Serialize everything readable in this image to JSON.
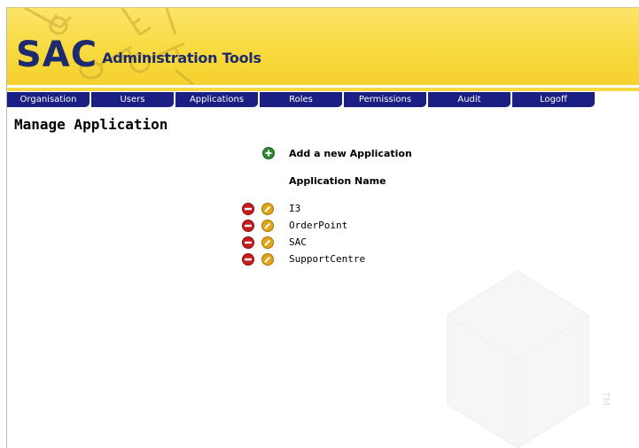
{
  "banner": {
    "logo_big": "SAC",
    "logo_small": "Administration Tools"
  },
  "nav": {
    "tabs": [
      "Organisation",
      "Users",
      "Applications",
      "Roles",
      "Permissions",
      "Audit",
      "Logoff"
    ]
  },
  "page": {
    "title": "Manage Application",
    "add_label": "Add a new Application",
    "column_header": "Application Name"
  },
  "applications": [
    "I3",
    "OrderPoint",
    "SAC",
    "SupportCentre"
  ],
  "colors": {
    "nav_bg": "#1b1f84",
    "banner": "#f8da3f",
    "logo_text": "#1e2a6e",
    "delete_icon": "#c41e1e",
    "edit_icon": "#e3a418",
    "add_icon": "#2e8b2e"
  },
  "icons": {
    "add": "plus-circle-icon",
    "delete": "minus-circle-icon",
    "edit": "pencil-circle-icon"
  },
  "watermark_text": "TM"
}
